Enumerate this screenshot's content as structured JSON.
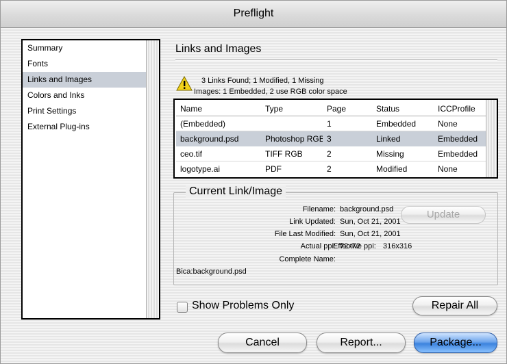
{
  "window": {
    "title": "Preflight"
  },
  "sidebar": {
    "items": [
      {
        "label": "Summary"
      },
      {
        "label": "Fonts"
      },
      {
        "label": "Links and Images"
      },
      {
        "label": "Colors and Inks"
      },
      {
        "label": "Print Settings"
      },
      {
        "label": "External Plug-ins"
      }
    ],
    "selected_index": 2
  },
  "section": {
    "title": "Links and Images",
    "summary_line1": "3 Links Found; 1 Modified, 1 Missing",
    "summary_line2": "Images: 1 Embedded, 2 use RGB color space",
    "warning_icon": "warning-triangle-icon"
  },
  "links_table": {
    "headers": [
      "Name",
      "Type",
      "Page",
      "Status",
      "ICCProfile"
    ],
    "rows": [
      [
        "(Embedded)",
        "",
        "1",
        "Embedded",
        "None"
      ],
      [
        "background.psd",
        "Photoshop RGB",
        "3",
        "Linked",
        "Embedded"
      ],
      [
        "ceo.tif",
        "TIFF RGB",
        "2",
        "Missing",
        "Embedded"
      ],
      [
        "logotype.ai",
        "PDF",
        "2",
        "Modified",
        "None"
      ]
    ],
    "selected_row": 1
  },
  "current_link": {
    "group_title": "Current Link/Image",
    "filename_label": "Filename:",
    "filename_value": "background.psd",
    "link_updated_label": "Link Updated:",
    "link_updated_value": "Sun, Oct 21, 2001",
    "file_modified_label": "File Last Modified:",
    "file_modified_value": "Sun, Oct 21, 2001",
    "actual_ppi_label": "Actual ppi:",
    "actual_ppi_value": "72x72",
    "effective_ppi_label": "Effective ppi:",
    "effective_ppi_value": "316x316",
    "complete_name_label": "Complete Name:",
    "complete_name_value": "Bica:background.psd",
    "update_button": "Update"
  },
  "options": {
    "show_problems_label": "Show Problems Only",
    "show_problems_checked": false,
    "repair_all_button": "Repair All"
  },
  "footer": {
    "cancel_button": "Cancel",
    "report_button": "Report...",
    "package_button": "Package..."
  },
  "colors": {
    "selection": "#c9cfd8",
    "default_button": "#3c83de",
    "warning_yellow": "#f2d21b"
  }
}
